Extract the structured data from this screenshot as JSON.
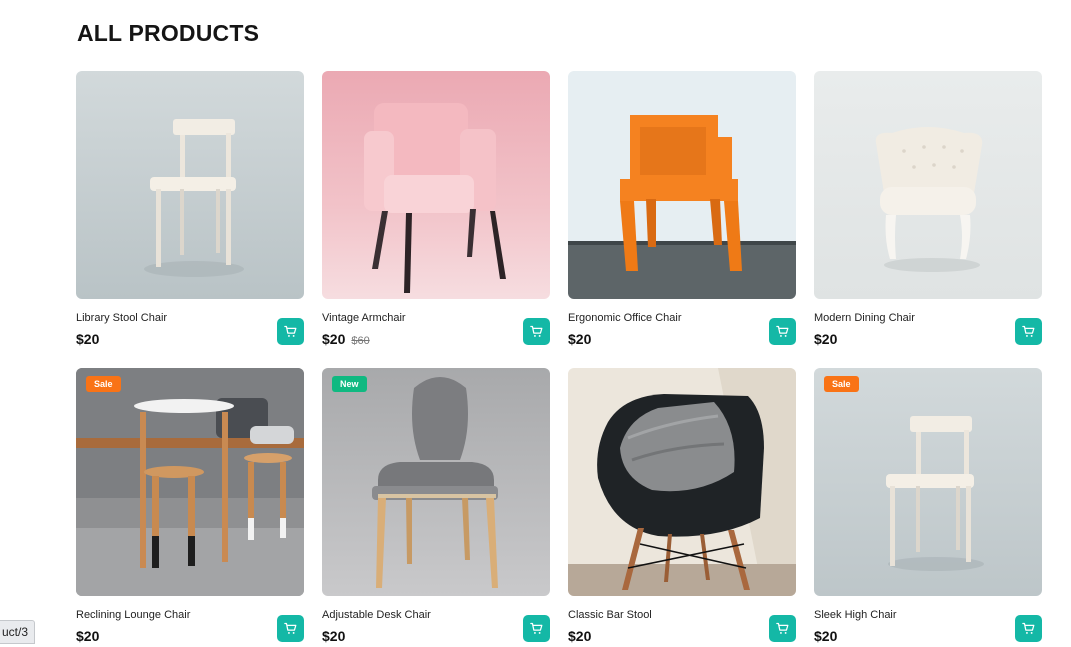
{
  "page": {
    "title": "ALL PRODUCTS"
  },
  "colors": {
    "accent": "#14b8a6",
    "sale_badge": "#f97316",
    "new_badge": "#10b981"
  },
  "products": [
    {
      "name": "Library Stool Chair",
      "price": "$20",
      "old_price": "",
      "badge": "",
      "image": "white-wooden-chair"
    },
    {
      "name": "Vintage Armchair",
      "price": "$20",
      "old_price": "$60",
      "badge": "",
      "image": "pink-armchair"
    },
    {
      "name": "Ergonomic Office Chair",
      "price": "$20",
      "old_price": "",
      "badge": "",
      "image": "orange-chair"
    },
    {
      "name": "Modern Dining Chair",
      "price": "$20",
      "old_price": "",
      "badge": "",
      "image": "tufted-white-chair"
    },
    {
      "name": "Reclining Lounge Chair",
      "price": "$20",
      "old_price": "",
      "badge": "Sale",
      "image": "wooden-table-stools"
    },
    {
      "name": "Adjustable Desk Chair",
      "price": "$20",
      "old_price": "",
      "badge": "New",
      "image": "gray-wooden-chair"
    },
    {
      "name": "Classic Bar Stool",
      "price": "$20",
      "old_price": "",
      "badge": "",
      "image": "black-chair-pillow"
    },
    {
      "name": "Sleek High Chair",
      "price": "$20",
      "old_price": "",
      "badge": "Sale",
      "image": "white-wooden-chair"
    }
  ],
  "status_bar": {
    "url_fragment": "uct/3"
  }
}
